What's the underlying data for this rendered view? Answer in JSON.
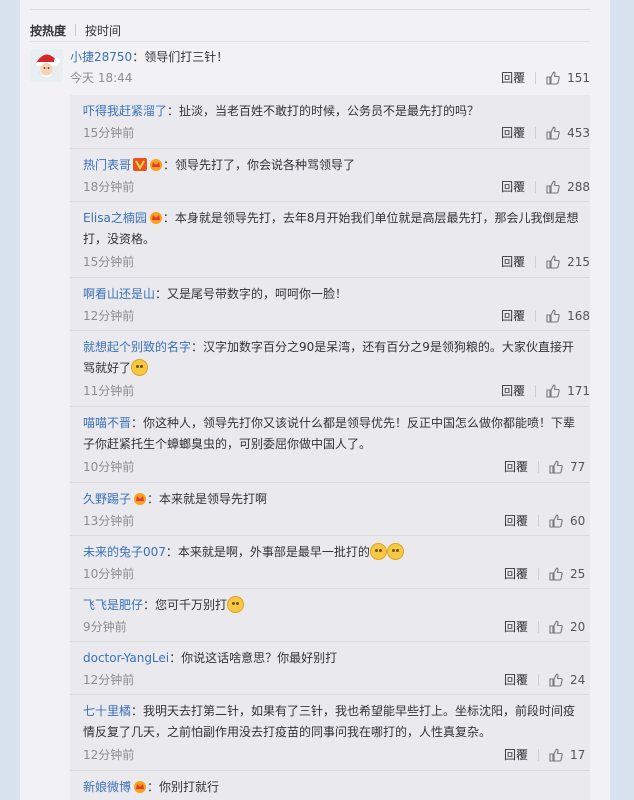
{
  "sort": {
    "hot": "按热度",
    "time": "按时间"
  },
  "main": {
    "user": "小捷28750",
    "sep": "：",
    "text": "领导们打三针！",
    "time": "今天 18:44",
    "reply": "回覆",
    "likes": "151"
  },
  "replies": [
    {
      "user": "吓得我赶紧溜了",
      "text": "：扯淡，当老百姓不敢打的时候，公务员不是最先打的吗？",
      "time": "15分钟前",
      "reply": "回覆",
      "likes": "453",
      "badges": []
    },
    {
      "user": "热门表哥",
      "text": "：领导先打了，你会说各种骂领导了",
      "time": "18分钟前",
      "reply": "回覆",
      "likes": "288",
      "badges": [
        "v",
        "vip"
      ]
    },
    {
      "user": "Elisa之楠园",
      "text": "：本身就是领导先打，去年8月开始我们单位就是高层最先打，那会儿我倒是想打，没资格。",
      "time": "15分钟前",
      "reply": "回覆",
      "likes": "215",
      "badges": [
        "vip"
      ]
    },
    {
      "user": "啊看山还是山",
      "text": "：又是尾号带数字的，呵呵你一脸！",
      "time": "12分钟前",
      "reply": "回覆",
      "likes": "168",
      "badges": []
    },
    {
      "user": "就想起个别致的名字",
      "text": "：汉字加数字百分之90是呆湾，还有百分之9是领狗粮的。大家伙直接开骂就好了",
      "time": "11分钟前",
      "reply": "回覆",
      "likes": "171",
      "badges": [],
      "emoji": 1
    },
    {
      "user": "喵喵不晋",
      "text": "：你这种人，领导先打你又该说什么都是领导优先！反正中国怎么做你都能喷！下辈子你赶紧托生个蟑螂臭虫的，可别委屈你做中国人了。",
      "time": "10分钟前",
      "reply": "回覆",
      "likes": "77",
      "badges": []
    },
    {
      "user": "久野踢子",
      "text": "：本来就是领导先打啊",
      "time": "13分钟前",
      "reply": "回覆",
      "likes": "60",
      "badges": [
        "vip"
      ]
    },
    {
      "user": "未来的兔子007",
      "text": "：本来就是啊，外事部是最早一批打的",
      "time": "10分钟前",
      "reply": "回覆",
      "likes": "25",
      "badges": [],
      "emoji": 2
    },
    {
      "user": "飞飞是肥仔",
      "text": "：您可千万别打",
      "time": "9分钟前",
      "reply": "回覆",
      "likes": "20",
      "badges": [],
      "emoji": 1
    },
    {
      "user": "doctor-YangLei",
      "text": "：你说这话啥意思？你最好别打",
      "time": "12分钟前",
      "reply": "回覆",
      "likes": "24",
      "badges": []
    },
    {
      "user": "七十里橘",
      "text": "：我明天去打第二针，如果有了三针，我也希望能早些打上。坐标沈阳，前段时间疫情反复了几天，之前怕副作用没去打疫苗的同事问我在哪打的，人性真复杂。",
      "time": "12分钟前",
      "reply": "回覆",
      "likes": "17",
      "badges": []
    },
    {
      "user": "新娘微博",
      "text": "：你别打就行",
      "time": "",
      "reply": "",
      "likes": "",
      "badges": [
        "vip"
      ]
    }
  ],
  "colors": {
    "username": "#3a71b8",
    "background": "#d9e3ef",
    "panel": "#f2f2f5",
    "reply_box": "#eaeaee"
  }
}
